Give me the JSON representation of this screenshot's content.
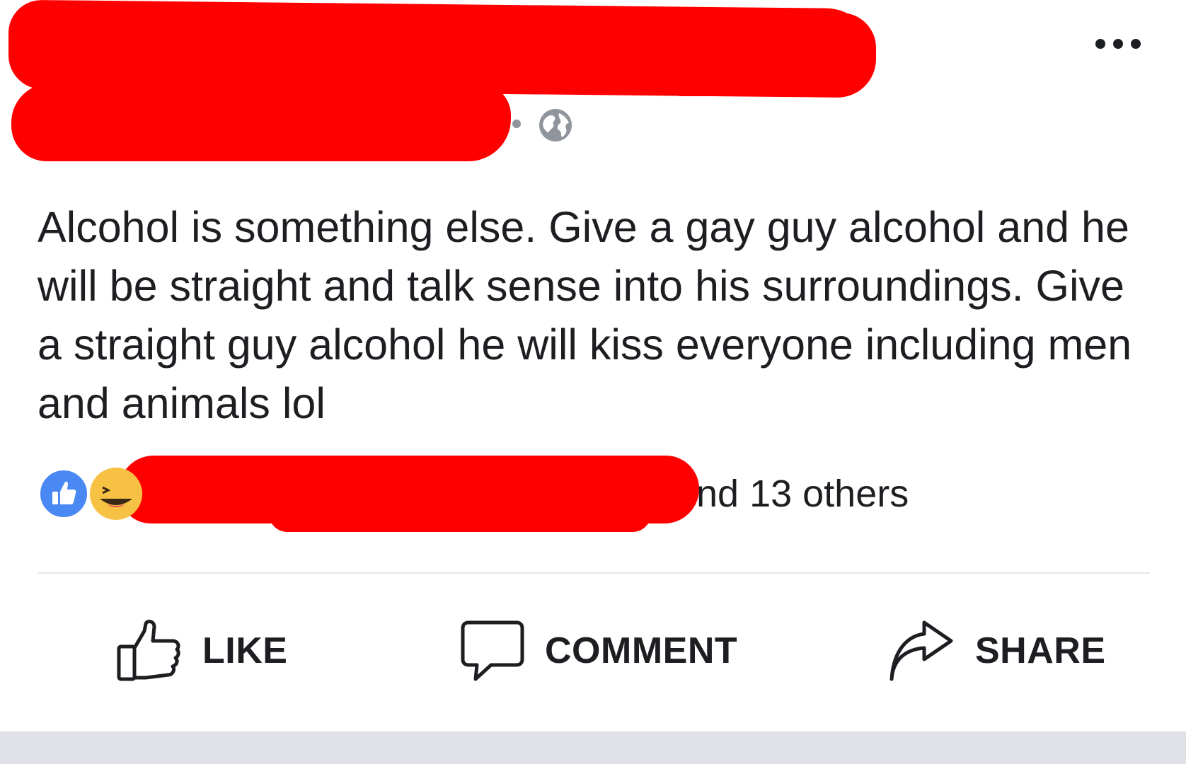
{
  "post": {
    "text": "Alcohol is something else. Give a gay guy alcohol and he will be straight and talk sense into his surroundings. Give a straight guy alcohol he will kiss everyone including men and animals lol",
    "privacy_icon": "globe-icon",
    "more_icon": "more-horizontal-icon"
  },
  "reactions": {
    "types": [
      "like",
      "haha"
    ],
    "summary_text": "nd 13 others"
  },
  "actions": {
    "like_label": "LIKE",
    "comment_label": "COMMENT",
    "share_label": "SHARE"
  },
  "colors": {
    "redaction": "#ff0000",
    "like_blue": "#4a89f3",
    "haha_yellow": "#f7c244",
    "text": "#1c1e21",
    "muted": "#90949c"
  }
}
